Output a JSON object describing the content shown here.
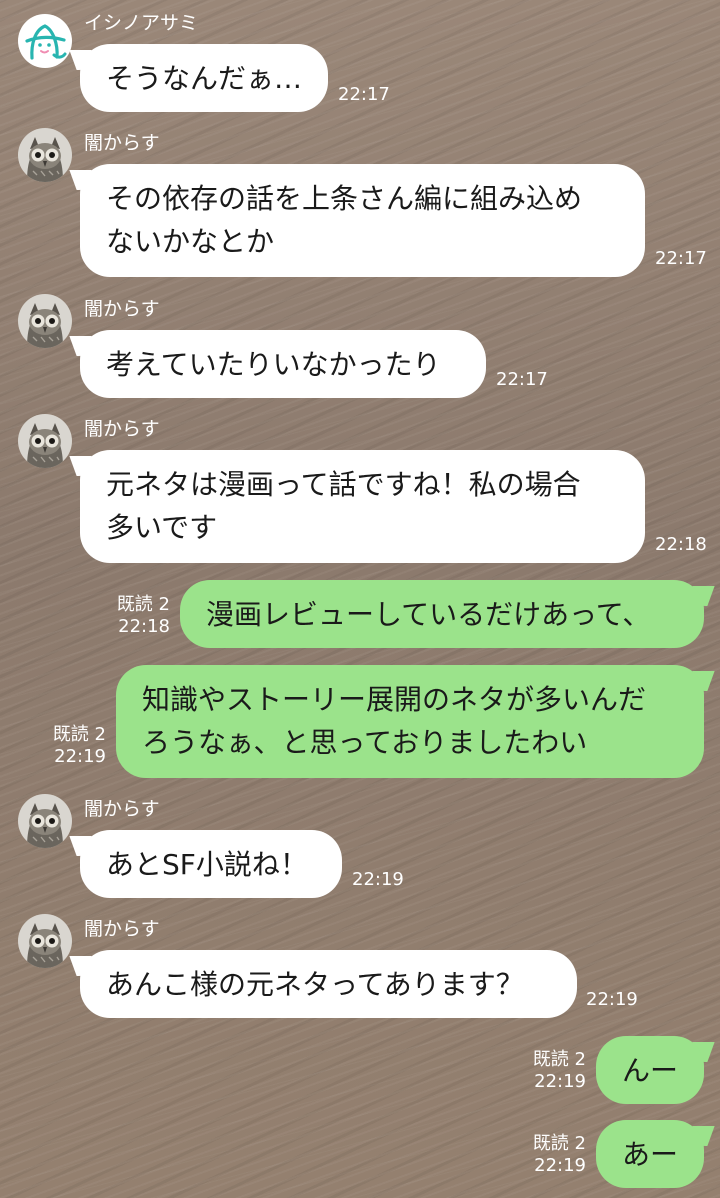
{
  "colors": {
    "incoming_bubble": "#ffffff",
    "outgoing_bubble": "#9be38b",
    "meta_text": "#ffffff"
  },
  "messages": [
    {
      "sender": "イシノアサミ",
      "avatar": "teal-logo-avatar",
      "lines": [
        "そうなんだぁ…"
      ],
      "time": "22:17"
    },
    {
      "sender": "闇からす",
      "avatar": "owl-avatar",
      "lines": [
        "その依存の話を上条さん編に組み込め",
        "ないかなとか"
      ],
      "time": "22:17"
    },
    {
      "sender": "闇からす",
      "avatar": "owl-avatar",
      "lines": [
        "考えていたりいなかったり"
      ],
      "time": "22:17"
    },
    {
      "sender": "闇からす",
      "avatar": "owl-avatar",
      "lines": [
        "元ネタは漫画って話ですね！私の場合",
        "多いです"
      ],
      "time": "22:18"
    },
    {
      "read": "既読 2",
      "lines": [
        "漫画レビューしているだけあって、"
      ],
      "time": "22:18"
    },
    {
      "read": "既読 2",
      "lines": [
        "知識やストーリー展開のネタが多いんだ",
        "ろうなぁ、と思っておりましたわい"
      ],
      "time": "22:19"
    },
    {
      "sender": "闇からす",
      "avatar": "owl-avatar",
      "lines": [
        "あとSF小説ね！"
      ],
      "time": "22:19"
    },
    {
      "sender": "闇からす",
      "avatar": "owl-avatar",
      "lines": [
        "あんこ様の元ネタってあります？"
      ],
      "time": "22:19"
    },
    {
      "read": "既読 2",
      "lines": [
        "んー"
      ],
      "time": "22:19"
    },
    {
      "read": "既読 2",
      "lines": [
        "あー"
      ],
      "time": "22:19"
    }
  ]
}
